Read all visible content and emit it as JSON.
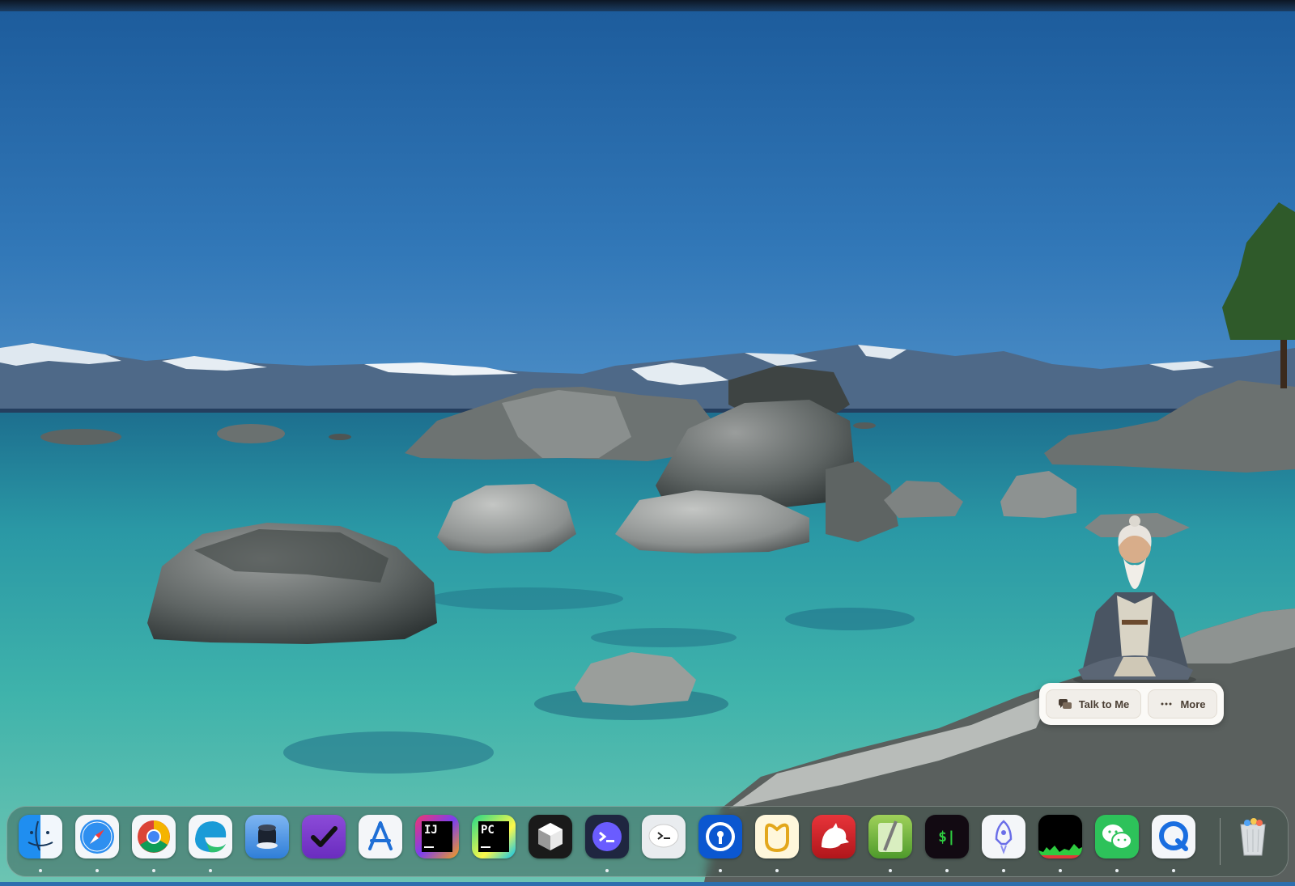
{
  "wallpaper": {
    "description_icon": "lake-tahoe-wallpaper"
  },
  "companion": {
    "avatar_icon": "sage-avatar-icon",
    "talk_label": "Talk to Me",
    "more_label": "More"
  },
  "dock": {
    "apps": [
      {
        "icon": "finder-icon",
        "running": true
      },
      {
        "icon": "safari-icon",
        "running": true
      },
      {
        "icon": "chrome-icon",
        "running": true
      },
      {
        "icon": "edge-icon",
        "running": true
      },
      {
        "icon": "gpg-keychain-icon",
        "running": false
      },
      {
        "icon": "omnifocus-icon",
        "running": false
      },
      {
        "icon": "app-store-icon",
        "running": false
      },
      {
        "icon": "intellij-idea-icon",
        "running": false,
        "label": "IJ"
      },
      {
        "icon": "pycharm-icon",
        "running": false,
        "label": "PC"
      },
      {
        "icon": "cube-icon",
        "running": false
      },
      {
        "icon": "warp-terminal-icon",
        "running": true
      },
      {
        "icon": "chat-bubble-terminal-icon",
        "running": false
      },
      {
        "icon": "password-manager-icon",
        "running": true
      },
      {
        "icon": "navicat-icon",
        "running": true
      },
      {
        "icon": "bear-icon",
        "running": false
      },
      {
        "icon": "script-editor-icon",
        "running": true
      },
      {
        "icon": "terminal-icon",
        "running": true,
        "label": "$|"
      },
      {
        "icon": "rocket-launcher-icon",
        "running": true
      },
      {
        "icon": "activity-monitor-icon",
        "running": true
      },
      {
        "icon": "wechat-icon",
        "running": true
      },
      {
        "icon": "quicktime-icon",
        "running": true
      },
      {
        "icon": "trash-icon",
        "running": false
      }
    ]
  }
}
